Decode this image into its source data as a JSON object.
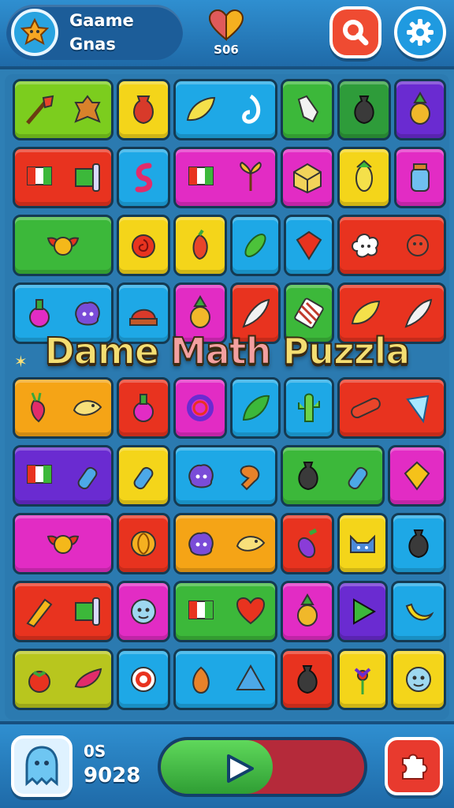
{
  "header": {
    "title_line1": "Gaame",
    "title_line2": "Gnas",
    "heart_value": "S06"
  },
  "banner": {
    "word1": "Dame ",
    "word2": "Math",
    "word3": " Puzzla"
  },
  "footer": {
    "stat_top": "0S",
    "stat_bottom": "9028",
    "progress": 0.55
  },
  "colors": {
    "green": "#3cb83a",
    "lime": "#7ccd1e",
    "yellow": "#f4d51a",
    "blue": "#1ea8e6",
    "red": "#e8331f",
    "magenta": "#e22cc4",
    "purple": "#6a2bd1",
    "orange": "#f5a416",
    "olive": "#b8c61e",
    "darkgreen": "#2e9c3a"
  },
  "tiles": [
    {
      "name": "tile-r1-1",
      "color": "lime",
      "icons": [
        "broom-icon",
        "cookie-man-icon"
      ]
    },
    {
      "name": "tile-r1-2",
      "color": "yellow",
      "icons": [
        "vase-icon"
      ]
    },
    {
      "name": "tile-r1-3",
      "color": "blue",
      "icons": [
        "leaf-icon",
        "swirl-icon"
      ]
    },
    {
      "name": "tile-r1-4",
      "color": "green",
      "icons": [
        "glove-icon"
      ]
    },
    {
      "name": "tile-r1-5",
      "color": "darkgreen",
      "icons": [
        "bag-icon"
      ]
    },
    {
      "name": "tile-r1-6",
      "color": "purple",
      "icons": [
        "pineapple-icon"
      ]
    },
    {
      "name": "tile-r2-1",
      "color": "red",
      "icons": [
        "flag-icon",
        "scroll-flag-icon"
      ]
    },
    {
      "name": "tile-r2-2",
      "color": "blue",
      "icons": [
        "snake-icon"
      ]
    },
    {
      "name": "tile-r2-3",
      "color": "magenta",
      "icons": [
        "flag-icon",
        "palm-leaf-icon"
      ]
    },
    {
      "name": "tile-r2-4",
      "color": "magenta",
      "icons": [
        "gift-box-icon"
      ]
    },
    {
      "name": "tile-r2-5",
      "color": "yellow",
      "icons": [
        "corn-icon"
      ]
    },
    {
      "name": "tile-r2-6",
      "color": "magenta",
      "icons": [
        "jar-icon"
      ]
    },
    {
      "name": "tile-r3-1",
      "color": "green",
      "icons": [
        "winged-emblem-icon"
      ]
    },
    {
      "name": "tile-r3-2",
      "color": "yellow",
      "icons": [
        "rose-icon"
      ]
    },
    {
      "name": "tile-r3-3",
      "color": "yellow",
      "icons": [
        "pepper-icon"
      ]
    },
    {
      "name": "tile-r3-4",
      "color": "blue",
      "icons": [
        "cucumber-icon"
      ]
    },
    {
      "name": "tile-r3-5",
      "color": "blue",
      "icons": [
        "gem-icon"
      ]
    },
    {
      "name": "tile-r3-6",
      "color": "red",
      "icons": [
        "cloud-face-icon",
        "sun-face-icon"
      ]
    },
    {
      "name": "tile-r4-1",
      "color": "blue",
      "icons": [
        "potion-icon",
        "monster-icon"
      ]
    },
    {
      "name": "tile-r4-2",
      "color": "blue",
      "icons": [
        "cake-icon"
      ]
    },
    {
      "name": "tile-r4-3",
      "color": "magenta",
      "icons": [
        "pineapple-icon"
      ]
    },
    {
      "name": "tile-r4-4",
      "color": "red",
      "icons": [
        "feather-icon"
      ]
    },
    {
      "name": "tile-r4-5",
      "color": "green",
      "icons": [
        "chocolate-icon"
      ]
    },
    {
      "name": "tile-r4-6",
      "color": "red",
      "icons": [
        "leaf-icon",
        "feather-icon"
      ]
    },
    {
      "name": "tile-r5-1",
      "color": "orange",
      "icons": [
        "radish-icon",
        "bird-icon"
      ]
    },
    {
      "name": "tile-r5-2",
      "color": "red",
      "icons": [
        "potion-icon"
      ]
    },
    {
      "name": "tile-r5-3",
      "color": "magenta",
      "icons": [
        "ring-icon"
      ]
    },
    {
      "name": "tile-r5-4",
      "color": "blue",
      "icons": [
        "spinach-icon"
      ]
    },
    {
      "name": "tile-r5-5",
      "color": "blue",
      "icons": [
        "cactus-icon"
      ]
    },
    {
      "name": "tile-r5-6",
      "color": "red",
      "icons": [
        "sausage-icon",
        "crystal-icon"
      ]
    },
    {
      "name": "tile-r6-1",
      "color": "purple",
      "icons": [
        "flag-icon",
        "bottle-icon"
      ]
    },
    {
      "name": "tile-r6-2",
      "color": "yellow",
      "icons": [
        "bottle-icon"
      ]
    },
    {
      "name": "tile-r6-3",
      "color": "blue",
      "icons": [
        "monster-icon",
        "drumstick-icon"
      ]
    },
    {
      "name": "tile-r6-4",
      "color": "green",
      "icons": [
        "bag-icon",
        "bottle-icon"
      ]
    },
    {
      "name": "tile-r6-5",
      "color": "magenta",
      "icons": [
        "kite-icon"
      ]
    },
    {
      "name": "tile-r7-1",
      "color": "magenta",
      "icons": [
        "winged-emblem-icon"
      ]
    },
    {
      "name": "tile-r7-2",
      "color": "red",
      "icons": [
        "shell-icon"
      ]
    },
    {
      "name": "tile-r7-3",
      "color": "orange",
      "icons": [
        "monster-icon",
        "bird-icon"
      ]
    },
    {
      "name": "tile-r7-4",
      "color": "red",
      "icons": [
        "eggplant-icon"
      ]
    },
    {
      "name": "tile-r7-5",
      "color": "yellow",
      "icons": [
        "cat-icon"
      ]
    },
    {
      "name": "tile-r7-6",
      "color": "blue",
      "icons": [
        "bag-icon"
      ]
    },
    {
      "name": "tile-r8-1",
      "color": "red",
      "icons": [
        "pen-icon",
        "scroll-flag-icon"
      ]
    },
    {
      "name": "tile-r8-2",
      "color": "magenta",
      "icons": [
        "face-icon"
      ]
    },
    {
      "name": "tile-r8-3",
      "color": "green",
      "icons": [
        "flag-icon",
        "heart-icon"
      ]
    },
    {
      "name": "tile-r8-4",
      "color": "magenta",
      "icons": [
        "pineapple-icon"
      ]
    },
    {
      "name": "tile-r8-5",
      "color": "purple",
      "icons": [
        "play-icon"
      ]
    },
    {
      "name": "tile-r8-6",
      "color": "blue",
      "icons": [
        "banana-icon"
      ]
    },
    {
      "name": "tile-r9-1",
      "color": "olive",
      "icons": [
        "tomato-icon",
        "candy-icon"
      ]
    },
    {
      "name": "tile-r9-2",
      "color": "blue",
      "icons": [
        "target-icon"
      ]
    },
    {
      "name": "tile-r9-3",
      "color": "blue",
      "icons": [
        "onion-icon",
        "cone-icon"
      ]
    },
    {
      "name": "tile-r9-4",
      "color": "red",
      "icons": [
        "bag-icon"
      ]
    },
    {
      "name": "tile-r9-5",
      "color": "yellow",
      "icons": [
        "flower-icon"
      ]
    },
    {
      "name": "tile-r9-6",
      "color": "yellow",
      "icons": [
        "face-icon"
      ]
    }
  ]
}
